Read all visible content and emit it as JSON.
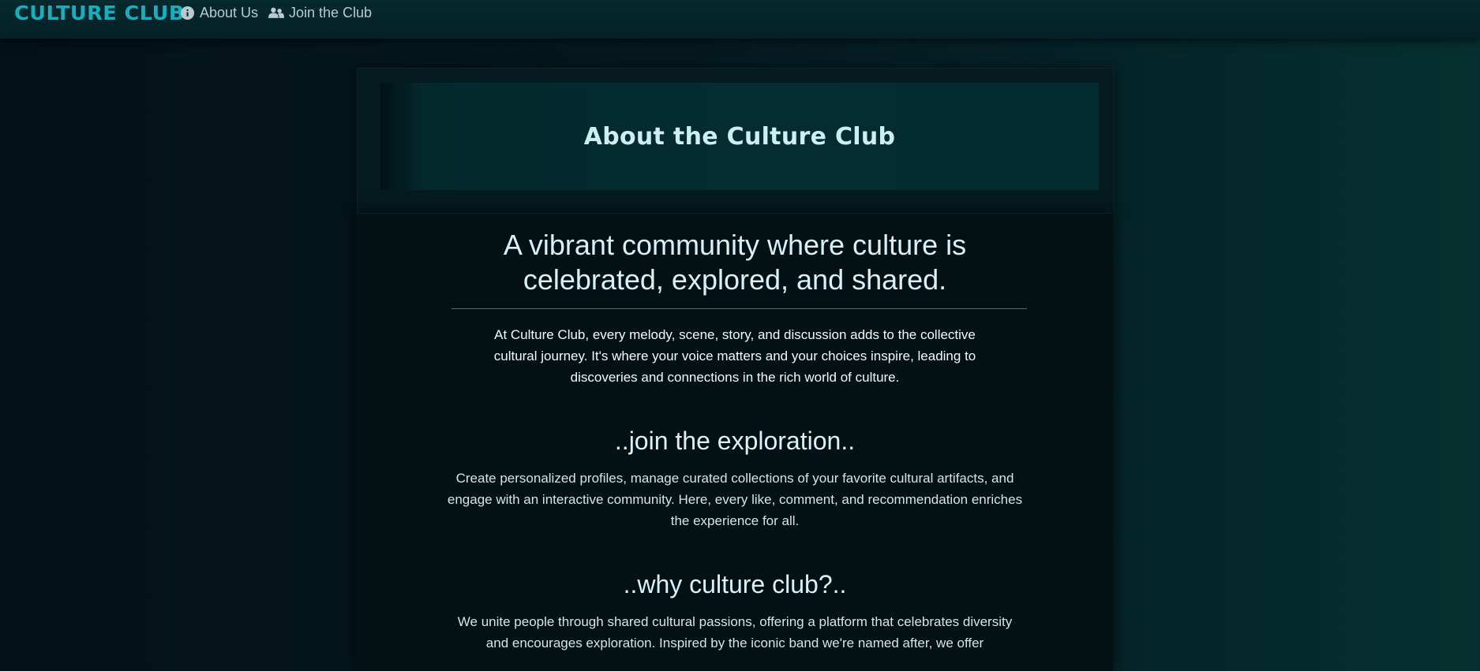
{
  "navbar": {
    "brand": "CULTURE CLUB",
    "links": [
      {
        "label": "About Us",
        "icon": "info-circle-icon"
      },
      {
        "label": "Join the Club",
        "icon": "users-icon"
      }
    ]
  },
  "header": {
    "title": "About the Culture Club"
  },
  "main": {
    "tagline": "A vibrant community where culture is celebrated, explored, and shared.",
    "intro": "At Culture Club, every melody, scene, story, and discussion adds to the collective cultural journey. It's where your voice matters and your choices inspire, leading to discoveries and connections in the rich world of culture.",
    "sections": [
      {
        "title": "..join the exploration..",
        "text": "Create personalized profiles, manage curated collections of your favorite cultural artifacts, and engage with an interactive community. Here, every like, comment, and recommendation enriches the experience for all."
      },
      {
        "title": "..why culture club?..",
        "text": "We unite people through shared cultural passions, offering a platform that celebrates diversity and encourages exploration. Inspired by the iconic band we're named after, we offer"
      }
    ]
  },
  "colors": {
    "brand": "#17aebd",
    "nav_text": "#b9c9cc",
    "background": "#031218",
    "header_card": "#042c31"
  }
}
